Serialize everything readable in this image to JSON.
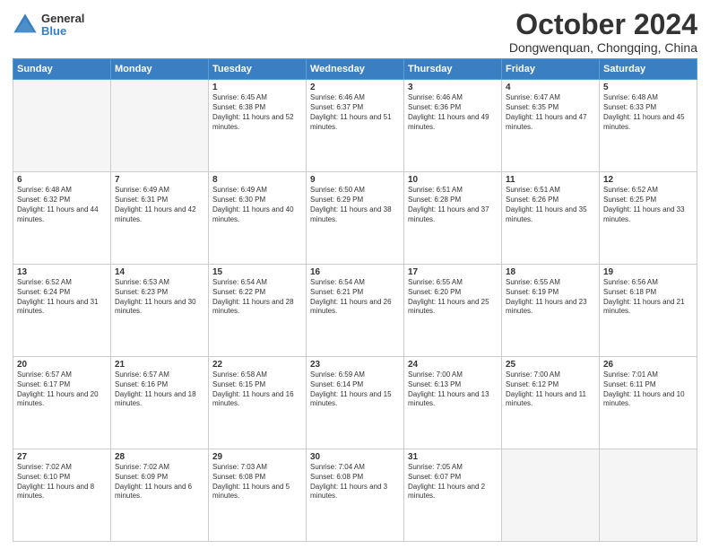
{
  "header": {
    "logo_general": "General",
    "logo_blue": "Blue",
    "month_title": "October 2024",
    "location": "Dongwenquan, Chongqing, China"
  },
  "weekdays": [
    "Sunday",
    "Monday",
    "Tuesday",
    "Wednesday",
    "Thursday",
    "Friday",
    "Saturday"
  ],
  "weeks": [
    [
      {
        "day": "",
        "info": ""
      },
      {
        "day": "",
        "info": ""
      },
      {
        "day": "1",
        "info": "Sunrise: 6:45 AM\nSunset: 6:38 PM\nDaylight: 11 hours and 52 minutes."
      },
      {
        "day": "2",
        "info": "Sunrise: 6:46 AM\nSunset: 6:37 PM\nDaylight: 11 hours and 51 minutes."
      },
      {
        "day": "3",
        "info": "Sunrise: 6:46 AM\nSunset: 6:36 PM\nDaylight: 11 hours and 49 minutes."
      },
      {
        "day": "4",
        "info": "Sunrise: 6:47 AM\nSunset: 6:35 PM\nDaylight: 11 hours and 47 minutes."
      },
      {
        "day": "5",
        "info": "Sunrise: 6:48 AM\nSunset: 6:33 PM\nDaylight: 11 hours and 45 minutes."
      }
    ],
    [
      {
        "day": "6",
        "info": "Sunrise: 6:48 AM\nSunset: 6:32 PM\nDaylight: 11 hours and 44 minutes."
      },
      {
        "day": "7",
        "info": "Sunrise: 6:49 AM\nSunset: 6:31 PM\nDaylight: 11 hours and 42 minutes."
      },
      {
        "day": "8",
        "info": "Sunrise: 6:49 AM\nSunset: 6:30 PM\nDaylight: 11 hours and 40 minutes."
      },
      {
        "day": "9",
        "info": "Sunrise: 6:50 AM\nSunset: 6:29 PM\nDaylight: 11 hours and 38 minutes."
      },
      {
        "day": "10",
        "info": "Sunrise: 6:51 AM\nSunset: 6:28 PM\nDaylight: 11 hours and 37 minutes."
      },
      {
        "day": "11",
        "info": "Sunrise: 6:51 AM\nSunset: 6:26 PM\nDaylight: 11 hours and 35 minutes."
      },
      {
        "day": "12",
        "info": "Sunrise: 6:52 AM\nSunset: 6:25 PM\nDaylight: 11 hours and 33 minutes."
      }
    ],
    [
      {
        "day": "13",
        "info": "Sunrise: 6:52 AM\nSunset: 6:24 PM\nDaylight: 11 hours and 31 minutes."
      },
      {
        "day": "14",
        "info": "Sunrise: 6:53 AM\nSunset: 6:23 PM\nDaylight: 11 hours and 30 minutes."
      },
      {
        "day": "15",
        "info": "Sunrise: 6:54 AM\nSunset: 6:22 PM\nDaylight: 11 hours and 28 minutes."
      },
      {
        "day": "16",
        "info": "Sunrise: 6:54 AM\nSunset: 6:21 PM\nDaylight: 11 hours and 26 minutes."
      },
      {
        "day": "17",
        "info": "Sunrise: 6:55 AM\nSunset: 6:20 PM\nDaylight: 11 hours and 25 minutes."
      },
      {
        "day": "18",
        "info": "Sunrise: 6:55 AM\nSunset: 6:19 PM\nDaylight: 11 hours and 23 minutes."
      },
      {
        "day": "19",
        "info": "Sunrise: 6:56 AM\nSunset: 6:18 PM\nDaylight: 11 hours and 21 minutes."
      }
    ],
    [
      {
        "day": "20",
        "info": "Sunrise: 6:57 AM\nSunset: 6:17 PM\nDaylight: 11 hours and 20 minutes."
      },
      {
        "day": "21",
        "info": "Sunrise: 6:57 AM\nSunset: 6:16 PM\nDaylight: 11 hours and 18 minutes."
      },
      {
        "day": "22",
        "info": "Sunrise: 6:58 AM\nSunset: 6:15 PM\nDaylight: 11 hours and 16 minutes."
      },
      {
        "day": "23",
        "info": "Sunrise: 6:59 AM\nSunset: 6:14 PM\nDaylight: 11 hours and 15 minutes."
      },
      {
        "day": "24",
        "info": "Sunrise: 7:00 AM\nSunset: 6:13 PM\nDaylight: 11 hours and 13 minutes."
      },
      {
        "day": "25",
        "info": "Sunrise: 7:00 AM\nSunset: 6:12 PM\nDaylight: 11 hours and 11 minutes."
      },
      {
        "day": "26",
        "info": "Sunrise: 7:01 AM\nSunset: 6:11 PM\nDaylight: 11 hours and 10 minutes."
      }
    ],
    [
      {
        "day": "27",
        "info": "Sunrise: 7:02 AM\nSunset: 6:10 PM\nDaylight: 11 hours and 8 minutes."
      },
      {
        "day": "28",
        "info": "Sunrise: 7:02 AM\nSunset: 6:09 PM\nDaylight: 11 hours and 6 minutes."
      },
      {
        "day": "29",
        "info": "Sunrise: 7:03 AM\nSunset: 6:08 PM\nDaylight: 11 hours and 5 minutes."
      },
      {
        "day": "30",
        "info": "Sunrise: 7:04 AM\nSunset: 6:08 PM\nDaylight: 11 hours and 3 minutes."
      },
      {
        "day": "31",
        "info": "Sunrise: 7:05 AM\nSunset: 6:07 PM\nDaylight: 11 hours and 2 minutes."
      },
      {
        "day": "",
        "info": ""
      },
      {
        "day": "",
        "info": ""
      }
    ]
  ]
}
